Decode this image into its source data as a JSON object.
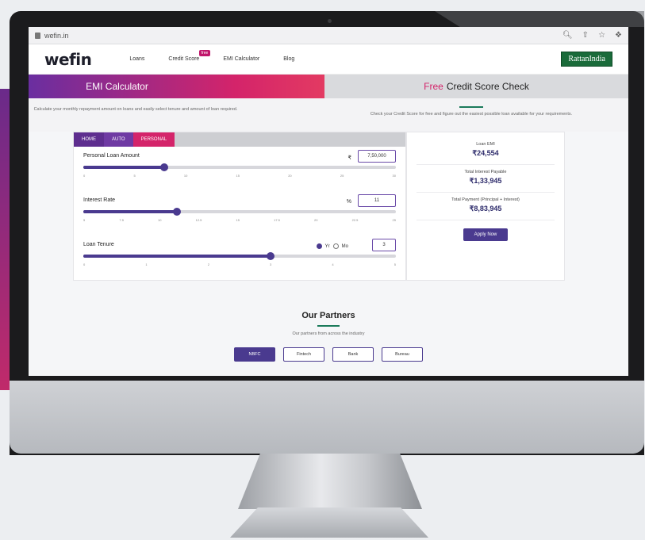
{
  "browser": {
    "url": "wefin.in"
  },
  "nav": {
    "logo": "wefin",
    "items": [
      {
        "label": "Loans"
      },
      {
        "label": "Credit Score",
        "badge": "free"
      },
      {
        "label": "EMI Calculator"
      },
      {
        "label": "Blog"
      }
    ],
    "partner_logo": "RattanIndia"
  },
  "headers": {
    "emi": "EMI Calculator",
    "free_prefix": "Free",
    "free_rest": "Credit Score Check"
  },
  "descriptions": {
    "left": "Calculate your monthly repayment amount on loans and easily select tenure and amount of loan required.",
    "right": "Check your Credit Score for free and figure out the easiest possible loan available for your requirements."
  },
  "tabs": [
    {
      "label": "HOME"
    },
    {
      "label": "AUTO"
    },
    {
      "label": "PERSONAL",
      "active": true
    }
  ],
  "fields": {
    "amount": {
      "label": "Personal Loan Amount",
      "unit": "₹",
      "value": "7,50,000",
      "percent": 26,
      "ticks": [
        "0",
        "5",
        "10",
        "15",
        "20",
        "25",
        "30"
      ]
    },
    "rate": {
      "label": "Interest Rate",
      "unit": "%",
      "value": "11",
      "percent": 30,
      "ticks": [
        "5",
        "7.5",
        "10",
        "12.5",
        "15",
        "17.5",
        "20",
        "22.5",
        "25"
      ]
    },
    "tenure": {
      "label": "Loan Tenure",
      "yr": "Yr",
      "mo": "Mo",
      "value": "3",
      "percent": 60,
      "ticks": [
        "0",
        "1",
        "2",
        "3",
        "4",
        "5"
      ]
    }
  },
  "results": {
    "emi_label": "Loan EMI",
    "emi_value": "₹24,554",
    "interest_label": "Total Interest Payable",
    "interest_value": "₹1,33,945",
    "total_label": "Total Payment (Principal + Interest)",
    "total_value": "₹8,83,945",
    "apply": "Apply Now"
  },
  "partners": {
    "title": "Our Partners",
    "subtitle": "Our partners from across the industry",
    "buttons": [
      {
        "label": "NBFC",
        "active": true
      },
      {
        "label": "Fintech"
      },
      {
        "label": "Bank"
      },
      {
        "label": "Bureau"
      }
    ]
  },
  "colors": {
    "brand_purple": "#4a3a8f",
    "brand_pink": "#d4246a",
    "accent_green": "#1a7a5a"
  }
}
